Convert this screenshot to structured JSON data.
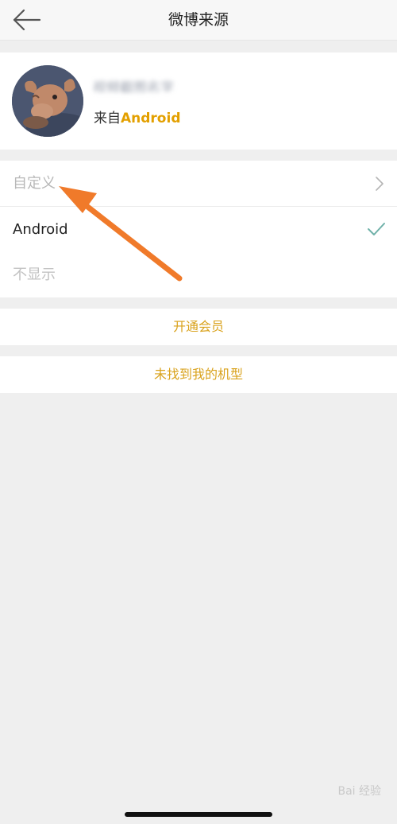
{
  "header": {
    "title": "微博来源",
    "back_icon": "arrow-left-icon"
  },
  "profile": {
    "username_blurred": "视频截图名字",
    "source_prefix": "来自",
    "source_device": "Android"
  },
  "options": [
    {
      "label": "自定义",
      "icon": "chevron-right-icon"
    },
    {
      "label": "Android",
      "icon": "checkmark-icon",
      "selected": true
    },
    {
      "label": "不显示"
    }
  ],
  "buttons": {
    "vip": "开通会员",
    "not_found": "未找到我的机型"
  },
  "colors": {
    "accent": "#d9a21c",
    "device": "#e3a000",
    "check": "#6fb1a9",
    "annotation_arrow": "#f07a2a"
  },
  "watermark": "Bai 经验"
}
